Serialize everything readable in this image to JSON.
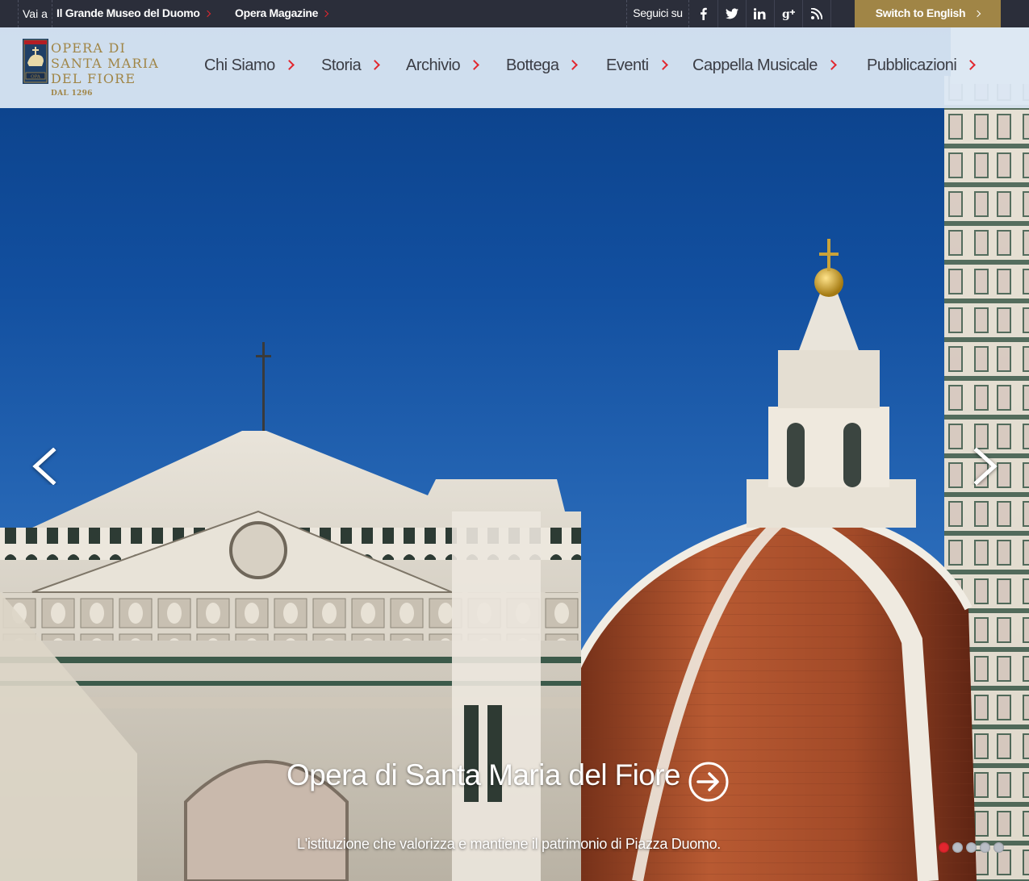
{
  "topbar": {
    "go_to_label": "Vai a",
    "links": [
      {
        "label": "Il Grande Museo del Duomo"
      },
      {
        "label": "Opera Magazine"
      }
    ],
    "follow_label": "Seguici su",
    "social": [
      {
        "icon": "facebook-icon",
        "glyph": "f"
      },
      {
        "icon": "twitter-icon",
        "glyph": "t"
      },
      {
        "icon": "linkedin-icon",
        "glyph": "in"
      },
      {
        "icon": "google-plus-icon",
        "glyph": "g+"
      },
      {
        "icon": "rss-icon",
        "glyph": "rss"
      }
    ],
    "switch_label": "Switch to English"
  },
  "logo": {
    "line1": "OPERA DI",
    "line2": "SANTA MARIA",
    "line3": "DEL FIORE",
    "since": "DAL 1296",
    "shield_text": "OPA"
  },
  "nav": {
    "items": [
      {
        "label": "Chi Siamo"
      },
      {
        "label": "Storia"
      },
      {
        "label": "Archivio"
      },
      {
        "label": "Bottega"
      },
      {
        "label": "Eventi"
      },
      {
        "label": "Cappella Musicale"
      },
      {
        "label": "Pubblicazioni"
      }
    ]
  },
  "slider": {
    "caption": "Opera di Santa Maria del Fiore",
    "subtitle": "L'istituzione che valorizza e mantiene il patrimonio di Piazza Duomo.",
    "slide_count": 5,
    "active_index": 0
  },
  "colors": {
    "topbar_bg": "#2b2e3a",
    "gold": "#a08546",
    "accent_red": "#e2262e",
    "nav_text": "#3b3d45"
  }
}
